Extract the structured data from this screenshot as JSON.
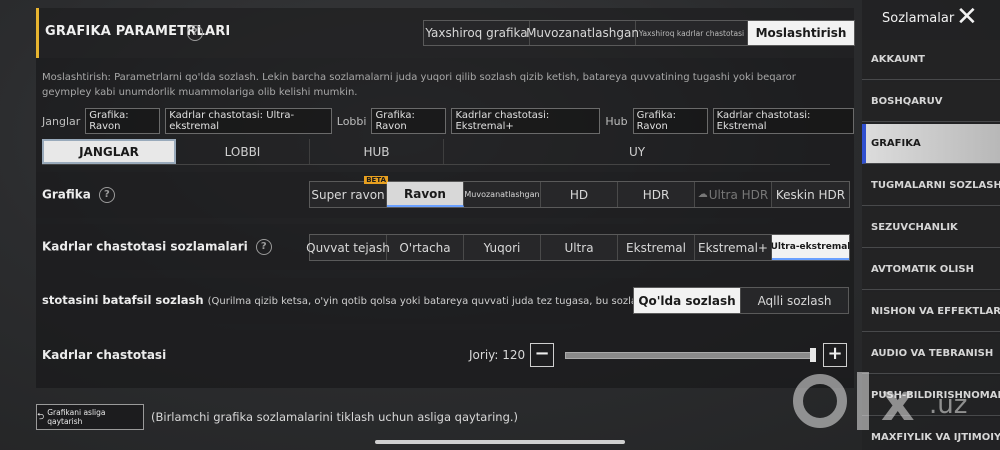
{
  "header": {
    "title": "GRAFIKA PARAMETRLARI",
    "presets": [
      "Yaxshiroq grafika",
      "Muvozanatlashgan",
      "Yaxshiroq kadrlar chastotasi",
      "Moslashtirish"
    ],
    "selected_preset": "Moslashtirish"
  },
  "description": "Moslashtirish: Parametrlarni qo'lda sozlash. Lekin barcha sozlamalarni juda yuqori qilib sozlash qizib ketish, batareya quvvatining tugashi yoki beqaror geympley kabi unumdorlik muammolariga olib kelishi mumkin.",
  "summary": {
    "janglar_label": "Janglar",
    "janglar_graphics": "Grafika: Ravon",
    "janglar_fps": "Kadrlar chastotasi: Ultra-ekstremal",
    "lobbi_label": "Lobbi",
    "lobbi_graphics": "Grafika: Ravon",
    "lobbi_fps": "Kadrlar chastotasi: Ekstremal+",
    "hub_label": "Hub",
    "hub_graphics": "Grafika: Ravon",
    "hub_fps": "Kadrlar chastotasi: Ekstremal"
  },
  "tabs": [
    "JANGLAR",
    "LOBBI",
    "HUB",
    "UY"
  ],
  "selected_tab": "JANGLAR",
  "grafika": {
    "label": "Grafika",
    "options": [
      "Super ravon",
      "Ravon",
      "Muvozanatlashgan",
      "HD",
      "HDR",
      "Ultra HDR",
      "Keskin HDR"
    ],
    "beta": "BETA",
    "selected": "Ravon"
  },
  "fps_settings": {
    "label": "Kadrlar chastotasi sozlamalari",
    "options": [
      "Quvvat tejash",
      "O'rtacha",
      "Yuqori",
      "Ultra",
      "Ekstremal",
      "Ekstremal+",
      "Ultra-ekstremal"
    ],
    "selected": "Ultra-ekstremal"
  },
  "detailed": {
    "label": "stotasini batafsil sozlash",
    "note": "(Qurilma qizib ketsa, o'yin qotib qolsa yoki batareya quvvati juda tez tugasa, bu sozlamani pasayti",
    "options": [
      "Qo'lda sozlash",
      "Aqlli sozlash"
    ],
    "selected": "Qo'lda sozlash"
  },
  "fps_slider": {
    "label": "Kadrlar chastotasi",
    "current": "Joriy: 120",
    "value_fraction": 1.0
  },
  "reset": {
    "button": "Grafikani asliga qaytarish",
    "note": "(Birlamchi grafika sozlamalarini tiklash uchun asliga qaytaring.)"
  },
  "sidebar": {
    "title": "Sozlamalar",
    "items": [
      "AKKAUNT",
      "BOSHQARUV",
      "GRAFIKA",
      "TUGMALARNI SOZLASH",
      "SEZUVCHANLIK",
      "AVTOMATIK OLISH",
      "NISHON VA EFFEKTLAR",
      "AUDIO VA TEBRANISH",
      "PUSH-BILDIRISHNOMALAR",
      "MAXFIYLIK VA IJTIMOIY TAR"
    ],
    "selected": "GRAFIKA"
  },
  "watermark": "olx.uz",
  "colors": {
    "accent": "#e8b530",
    "selected_bg": "#f2f2f2",
    "sidebar_marker": "#3050d0"
  }
}
